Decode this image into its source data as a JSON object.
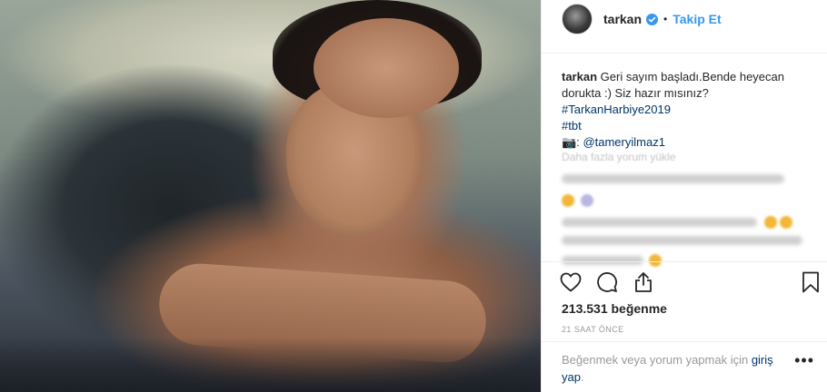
{
  "header": {
    "username": "tarkan",
    "dot": "•",
    "follow_label": "Takip Et"
  },
  "caption": {
    "username": "tarkan",
    "text": "Geri sayım başladı.Bende heyecan dorukta :) Siz hazır mısınız?",
    "hashtag_1": "#TarkanHarbiye2019",
    "hashtag_2": "#tbt",
    "camera_glyph": "📷:",
    "mention": "@tameryilmaz1"
  },
  "comments": {
    "load_more": "Daha fazla yorum yükle"
  },
  "stats": {
    "likes": "213.531 beğenme",
    "time": "21 SAAT ÖNCE"
  },
  "comment_box": {
    "prompt": "Beğenmek veya yorum yapmak için ",
    "login_link": "giriş yap",
    "suffix": ".",
    "options": "•••"
  },
  "colors": {
    "accent": "#3897f0",
    "link": "#003569",
    "muted": "#999999"
  },
  "icons": {
    "verified": "verified-badge-icon",
    "like": "heart-icon",
    "comment": "comment-icon",
    "share": "share-icon",
    "save": "bookmark-icon",
    "options": "more-options-icon"
  }
}
